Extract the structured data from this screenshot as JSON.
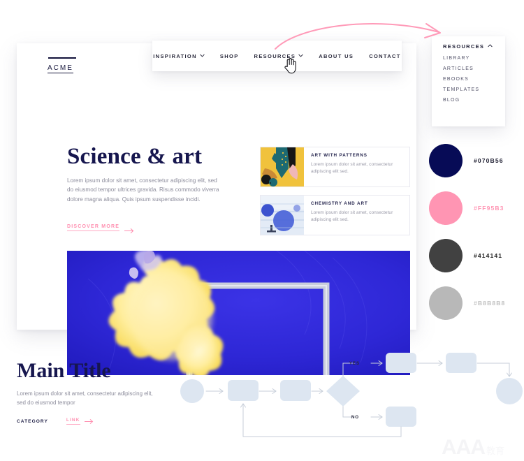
{
  "brand": {
    "name": "ACME"
  },
  "nav": {
    "items": [
      {
        "label": "INSPIRATION",
        "caret": "chevron-down-icon"
      },
      {
        "label": "SHOP",
        "caret": ""
      },
      {
        "label": "RESOURCES",
        "caret": "chevron-down-icon"
      },
      {
        "label": "ABOUT US",
        "caret": ""
      },
      {
        "label": "CONTACT",
        "caret": ""
      }
    ]
  },
  "dropdown": {
    "title": "RESOURCES",
    "caret": "chevron-up-icon",
    "items": [
      {
        "label": "LIBRARY"
      },
      {
        "label": "ARTICLES"
      },
      {
        "label": "EBOOKS"
      },
      {
        "label": "TEMPLATES"
      },
      {
        "label": "BLOG"
      }
    ]
  },
  "hero": {
    "title": "Science & art",
    "paragraph": "Lorem ipsum dolor sit amet, consectetur adipiscing elit, sed do eiusmod tempor ultrices gravida. Risus commodo viverra dolore magna aliqua. Quis ipsum suspendisse incidi.",
    "cta": "DISCOVER MORE"
  },
  "feature_cards": [
    {
      "title": "ART WITH PATTERNS",
      "description": "Lorem ipsum dolor sit amet, consectetur adipiscing elit sed."
    },
    {
      "title": "CHEMISTRY AND ART",
      "description": "Lorem ipsum dolor sit amet, consectetur adipiscing elit sed."
    }
  ],
  "swatches": [
    {
      "hex": "#070B56",
      "label": "#070B56",
      "label_color": "#1b1b2e"
    },
    {
      "hex": "#FF95B3",
      "label": "#FF95B3",
      "label_color": "#ff95b3"
    },
    {
      "hex": "#414141",
      "label": "#414141",
      "label_color": "#262626"
    },
    {
      "hex": "#B8B8B8",
      "label": "#B8B8B8",
      "label_color": "#c2c2c2"
    }
  ],
  "lower": {
    "title": "Main Title",
    "paragraph": "Lorem ipsum dolor sit amet, consectetur adipiscing elit, sed do eiusmod tempor",
    "category": "CATEGORY",
    "link": "LINK"
  },
  "flowchart": {
    "yes_label": "YES",
    "no_label": "NO",
    "shape_fill": "#dde6f1"
  },
  "watermark": {
    "letters": "AAA",
    "cn": "教育"
  }
}
